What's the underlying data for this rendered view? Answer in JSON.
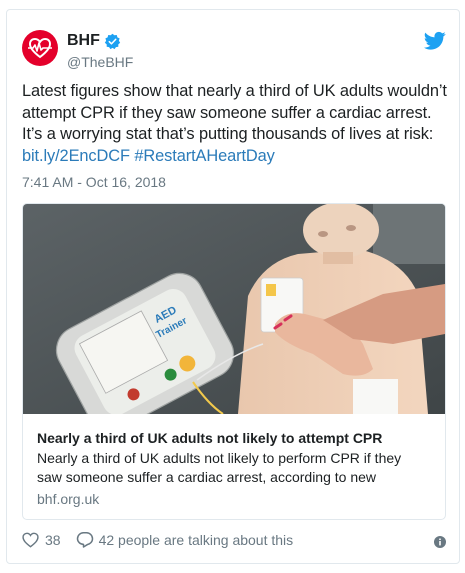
{
  "account": {
    "display_name": "BHF",
    "handle": "@TheBHF",
    "verified": true
  },
  "tweet": {
    "text_lines": [
      "Latest figures show that nearly a third of UK adults wouldn’t",
      "attempt CPR if they saw someone suffer a cardiac arrest.",
      "It’s a worrying stat that’s putting thousands of lives at risk:"
    ],
    "link": "bit.ly/2EncDCF",
    "hashtag": "#RestartAHeartDay",
    "timestamp": "7:41 AM - Oct 16, 2018"
  },
  "card": {
    "title": "Nearly a third of UK adults not likely to attempt CPR",
    "description_lines": [
      "Nearly a third of UK adults not likely to perform CPR if they",
      "saw someone suffer a cardiac arrest, according to new"
    ],
    "domain": "bhf.org.uk",
    "image_text": {
      "aed_label": "AED",
      "aed_label_2": "Trainer"
    }
  },
  "actions": {
    "like_count": "38",
    "conversation_text": "42 people are talking about this"
  },
  "colors": {
    "link": "#2b7bb9",
    "brand_red": "#e4002b",
    "twitter_blue": "#1da1f2",
    "muted": "#697882"
  },
  "icons": [
    "bhf-heart-logo-icon",
    "verified-badge-icon",
    "twitter-bird-icon",
    "heart-icon",
    "reply-icon",
    "info-icon"
  ]
}
